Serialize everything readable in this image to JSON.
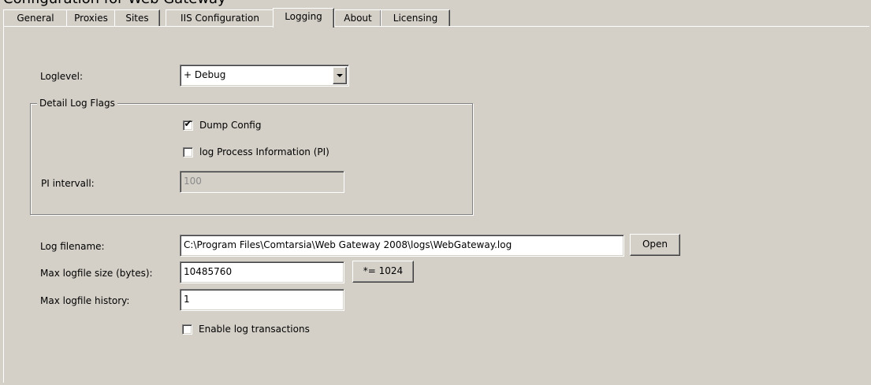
{
  "window": {
    "title": "Configuration for Web Gateway"
  },
  "tabs": [
    {
      "label": "General"
    },
    {
      "label": "Proxies"
    },
    {
      "label": "Sites"
    },
    {
      "label": "IIS Configuration"
    },
    {
      "label": "Logging",
      "active": true
    },
    {
      "label": "About"
    },
    {
      "label": "Licensing"
    }
  ],
  "logging": {
    "loglevel_label": "Loglevel:",
    "loglevel_value": "+ Debug",
    "detail_group_title": "Detail Log Flags",
    "dump_config_label": "Dump Config",
    "dump_config_checked": true,
    "log_pi_label": "log Process Information (PI)",
    "log_pi_checked": false,
    "pi_interval_label": "PI intervall:",
    "pi_interval_value": "100",
    "log_filename_label": "Log filename:",
    "log_filename_value": "C:\\Program Files\\Comtarsia\\Web Gateway 2008\\logs\\WebGateway.log",
    "open_button": "Open",
    "max_size_label": "Max logfile size (bytes):",
    "max_size_value": "10485760",
    "multiply_button": "*= 1024",
    "max_history_label": "Max logfile history:",
    "max_history_value": "1",
    "enable_transactions_label": "Enable log transactions",
    "enable_transactions_checked": false
  },
  "check_glyph": "✔"
}
